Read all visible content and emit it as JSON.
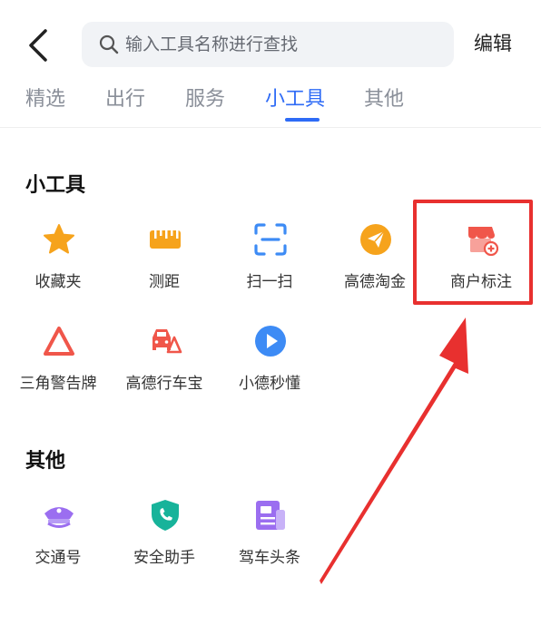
{
  "header": {
    "search_placeholder": "输入工具名称进行查找",
    "edit_label": "编辑"
  },
  "tabs": [
    {
      "label": "精选",
      "active": false
    },
    {
      "label": "出行",
      "active": false
    },
    {
      "label": "服务",
      "active": false
    },
    {
      "label": "小工具",
      "active": true
    },
    {
      "label": "其他",
      "active": false
    }
  ],
  "sections": [
    {
      "title": "小工具",
      "items": [
        {
          "label": "收藏夹",
          "icon": "star-icon"
        },
        {
          "label": "测距",
          "icon": "ruler-icon"
        },
        {
          "label": "扫一扫",
          "icon": "scan-icon"
        },
        {
          "label": "高德淘金",
          "icon": "paper-plane-icon"
        },
        {
          "label": "商户标注",
          "icon": "shop-add-icon",
          "highlighted": true
        },
        {
          "label": "三角警告牌",
          "icon": "warning-triangle-icon"
        },
        {
          "label": "高德行车宝",
          "icon": "car-warning-icon"
        },
        {
          "label": "小德秒懂",
          "icon": "play-icon"
        }
      ]
    },
    {
      "title": "其他",
      "items": [
        {
          "label": "交通号",
          "icon": "police-cap-icon"
        },
        {
          "label": "安全助手",
          "icon": "shield-phone-icon"
        },
        {
          "label": "驾车头条",
          "icon": "news-icon"
        }
      ]
    }
  ],
  "colors": {
    "accent": "#2e6bf6",
    "highlight": "#e8302f",
    "star": "#f6a31c",
    "warning": "#f0564a",
    "scan": "#3d8bf5",
    "purple": "#9b6ef0",
    "teal": "#17b39a"
  }
}
